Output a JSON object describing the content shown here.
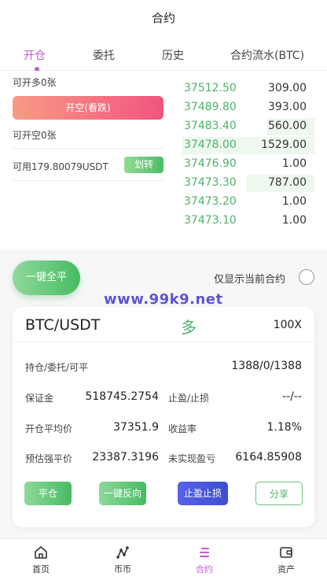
{
  "header": {
    "title": "合约"
  },
  "tabs": [
    {
      "label": "开仓"
    },
    {
      "label": "委托"
    },
    {
      "label": "历史"
    },
    {
      "label": "合约流水(BTC)"
    }
  ],
  "trade": {
    "can_open_long": "可开多0张",
    "short_button": "开空(看跌)",
    "can_open_short": "可开空0张",
    "available": "可用179.80079USDT",
    "transfer_button": "划转"
  },
  "orderbook": [
    {
      "price": "37512.50",
      "qty": "309.00",
      "depth": 0
    },
    {
      "price": "37489.80",
      "qty": "393.00",
      "depth": 0
    },
    {
      "price": "37483.40",
      "qty": "560.00",
      "depth": 0.36
    },
    {
      "price": "37478.00",
      "qty": "1529.00",
      "depth": 1
    },
    {
      "price": "37476.90",
      "qty": "1.00",
      "depth": 0
    },
    {
      "price": "37473.30",
      "qty": "787.00",
      "depth": 0.51
    },
    {
      "price": "37473.20",
      "qty": "1.00",
      "depth": 0
    },
    {
      "price": "37473.10",
      "qty": "1.00",
      "depth": 0
    }
  ],
  "controls": {
    "close_all": "一键全平",
    "only_current": "仅显示当前合约"
  },
  "watermark": "www.99k9.net",
  "position": {
    "pair": "BTC/USDT",
    "direction": "多",
    "leverage": "100X",
    "hold_label": "持仓/委托/可平",
    "hold_value": "1388/0/1388",
    "margin_label": "保证金",
    "margin_value": "518745.2754",
    "tpsl_label": "止盈/止损",
    "tpsl_value": "--/--",
    "avg_label": "开仓平均价",
    "avg_value": "37351.9",
    "yield_label": "收益率",
    "yield_value": "1.18%",
    "liq_label": "预估强平价",
    "liq_value": "23387.3196",
    "pnl_label": "未实现盈亏",
    "pnl_value": "6164.85908",
    "btn_close": "平仓",
    "btn_reverse": "一键反向",
    "btn_tpsl": "止盈止损",
    "btn_share": "分享"
  },
  "nav": [
    {
      "label": "首页",
      "icon": "home-icon"
    },
    {
      "label": "币币",
      "icon": "coin-icon"
    },
    {
      "label": "合约",
      "icon": "contract-icon"
    },
    {
      "label": "资产",
      "icon": "wallet-icon"
    }
  ],
  "colors": {
    "accent": "#c25bd0",
    "up": "#4cb36a",
    "short": "#f2557f",
    "blue": "#3c4fcf"
  }
}
